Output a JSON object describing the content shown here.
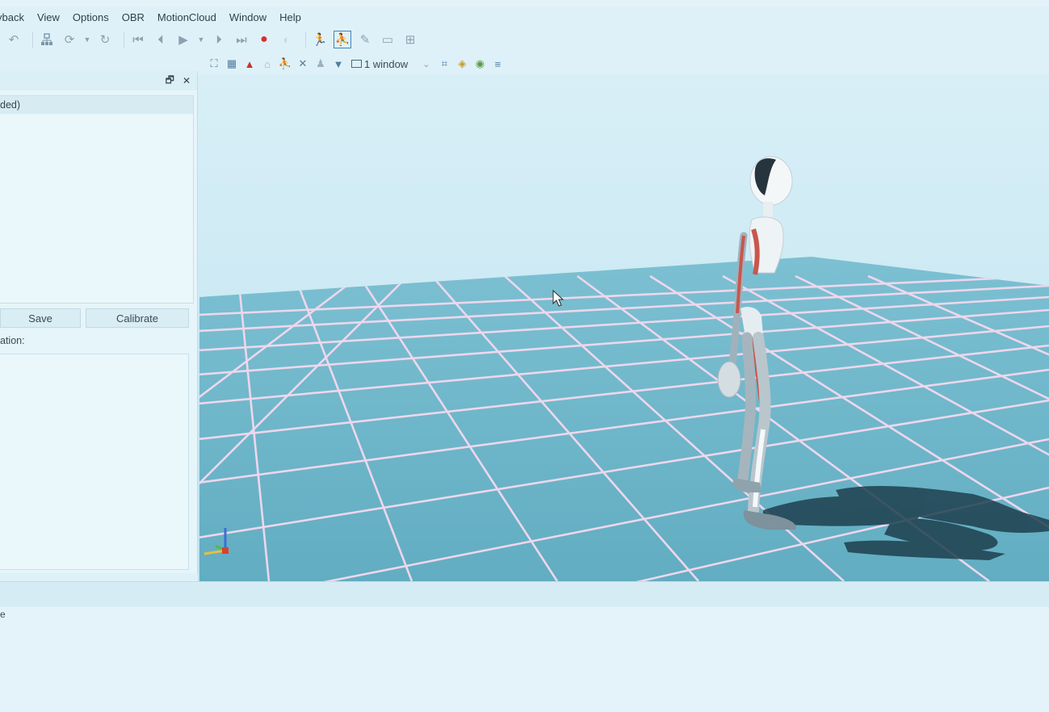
{
  "menubar": {
    "items": [
      "yback",
      "View",
      "Options",
      "OBR",
      "MotionCloud",
      "Window",
      "Help"
    ]
  },
  "toolbar": {
    "icons": [
      "undo-icon",
      "network-icon",
      "sync-icon",
      "refresh-icon",
      "skip-start-icon",
      "step-back-icon",
      "play-icon",
      "step-forward-icon",
      "skip-end-icon",
      "record-icon",
      "stop-icon",
      "skeleton-icon",
      "skeleton-active-icon",
      "pencil-icon",
      "grid-icon",
      "layout-icon"
    ]
  },
  "viewbar": {
    "window_label": "1 window"
  },
  "panel": {
    "list_header": "ded)",
    "save_label": "Save",
    "calibrate_label": "Calibrate",
    "info_label": "ation:",
    "restore_glyph": "🗗",
    "close_glyph": "✕"
  },
  "bottom": {
    "fragment": "e"
  },
  "colors": {
    "floor": "#6fb6c9",
    "grid": "#f0d6ec",
    "sky": "#d2ecf5",
    "accent": "#3f83b8",
    "record": "#d9302e"
  }
}
